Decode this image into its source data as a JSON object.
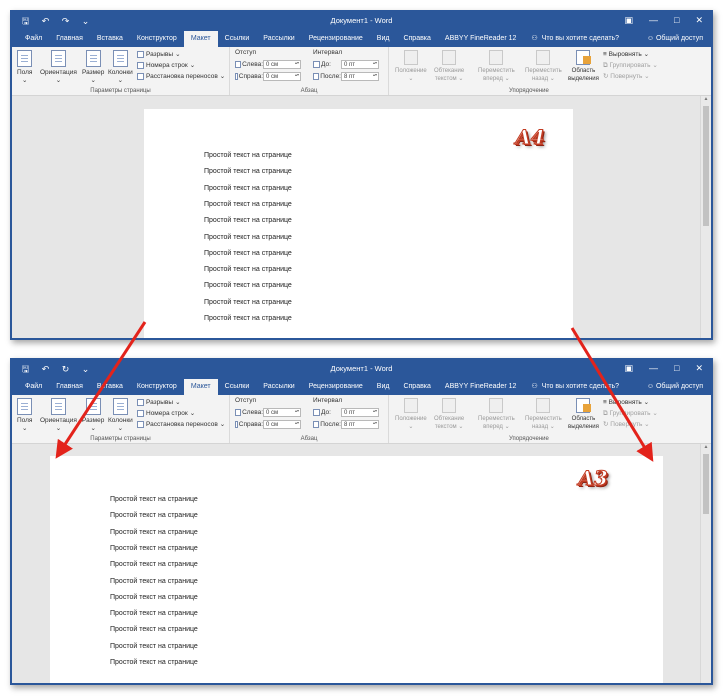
{
  "app": {
    "title": "Документ1 - Word",
    "quick_access": [
      "save-icon",
      "undo-icon",
      "redo-icon",
      "customize-icon"
    ],
    "window_controls": [
      "ribbon-display-icon",
      "minimize-icon",
      "maximize-icon",
      "close-icon"
    ]
  },
  "tabs": [
    "Файл",
    "Главная",
    "Вставка",
    "Конструктор",
    "Макет",
    "Ссылки",
    "Рассылки",
    "Рецензирование",
    "Вид",
    "Справка",
    "ABBYY FineReader 12"
  ],
  "active_tab": "Макет",
  "search_placeholder": "Что вы хотите сделать?",
  "share": "Общий доступ",
  "ribbon": {
    "page_setup": {
      "fields": "Поля",
      "orientation": "Ориентация",
      "size": "Размер",
      "columns": "Колонки",
      "breaks": "Разрывы",
      "line_numbers": "Номера строк",
      "hyphenation": "Расстановка переносов",
      "label": "Параметры страницы"
    },
    "paragraph": {
      "indent_title": "Отступ",
      "spacing_title": "Интервал",
      "left_label": "Слева:",
      "left_value": "0 см",
      "right_label": "Справа:",
      "right_value": "0 см",
      "before_label": "До:",
      "before_value": "0 пт",
      "after_label": "После:",
      "after_value": "8 пт",
      "label": "Абзац"
    },
    "arrange": {
      "position": [
        "Положение",
        ""
      ],
      "wrap": [
        "Обтекание",
        "текстом"
      ],
      "forward": [
        "Переместить",
        "вперед"
      ],
      "backward": [
        "Переместить",
        "назад"
      ],
      "pane": [
        "Область",
        "выделения"
      ],
      "align": "Выровнять",
      "group": "Группировать",
      "rotate": "Повернуть",
      "label": "Упорядочение"
    }
  },
  "document": {
    "line_text": "Простой текст на странице",
    "a4_lines": 11,
    "a3_lines": 11
  },
  "labels": {
    "a4": "А4",
    "a3": "А3"
  },
  "colors": {
    "word_blue": "#2b579a",
    "arrow_red": "#e3231b",
    "label_red": "#c23b22"
  }
}
